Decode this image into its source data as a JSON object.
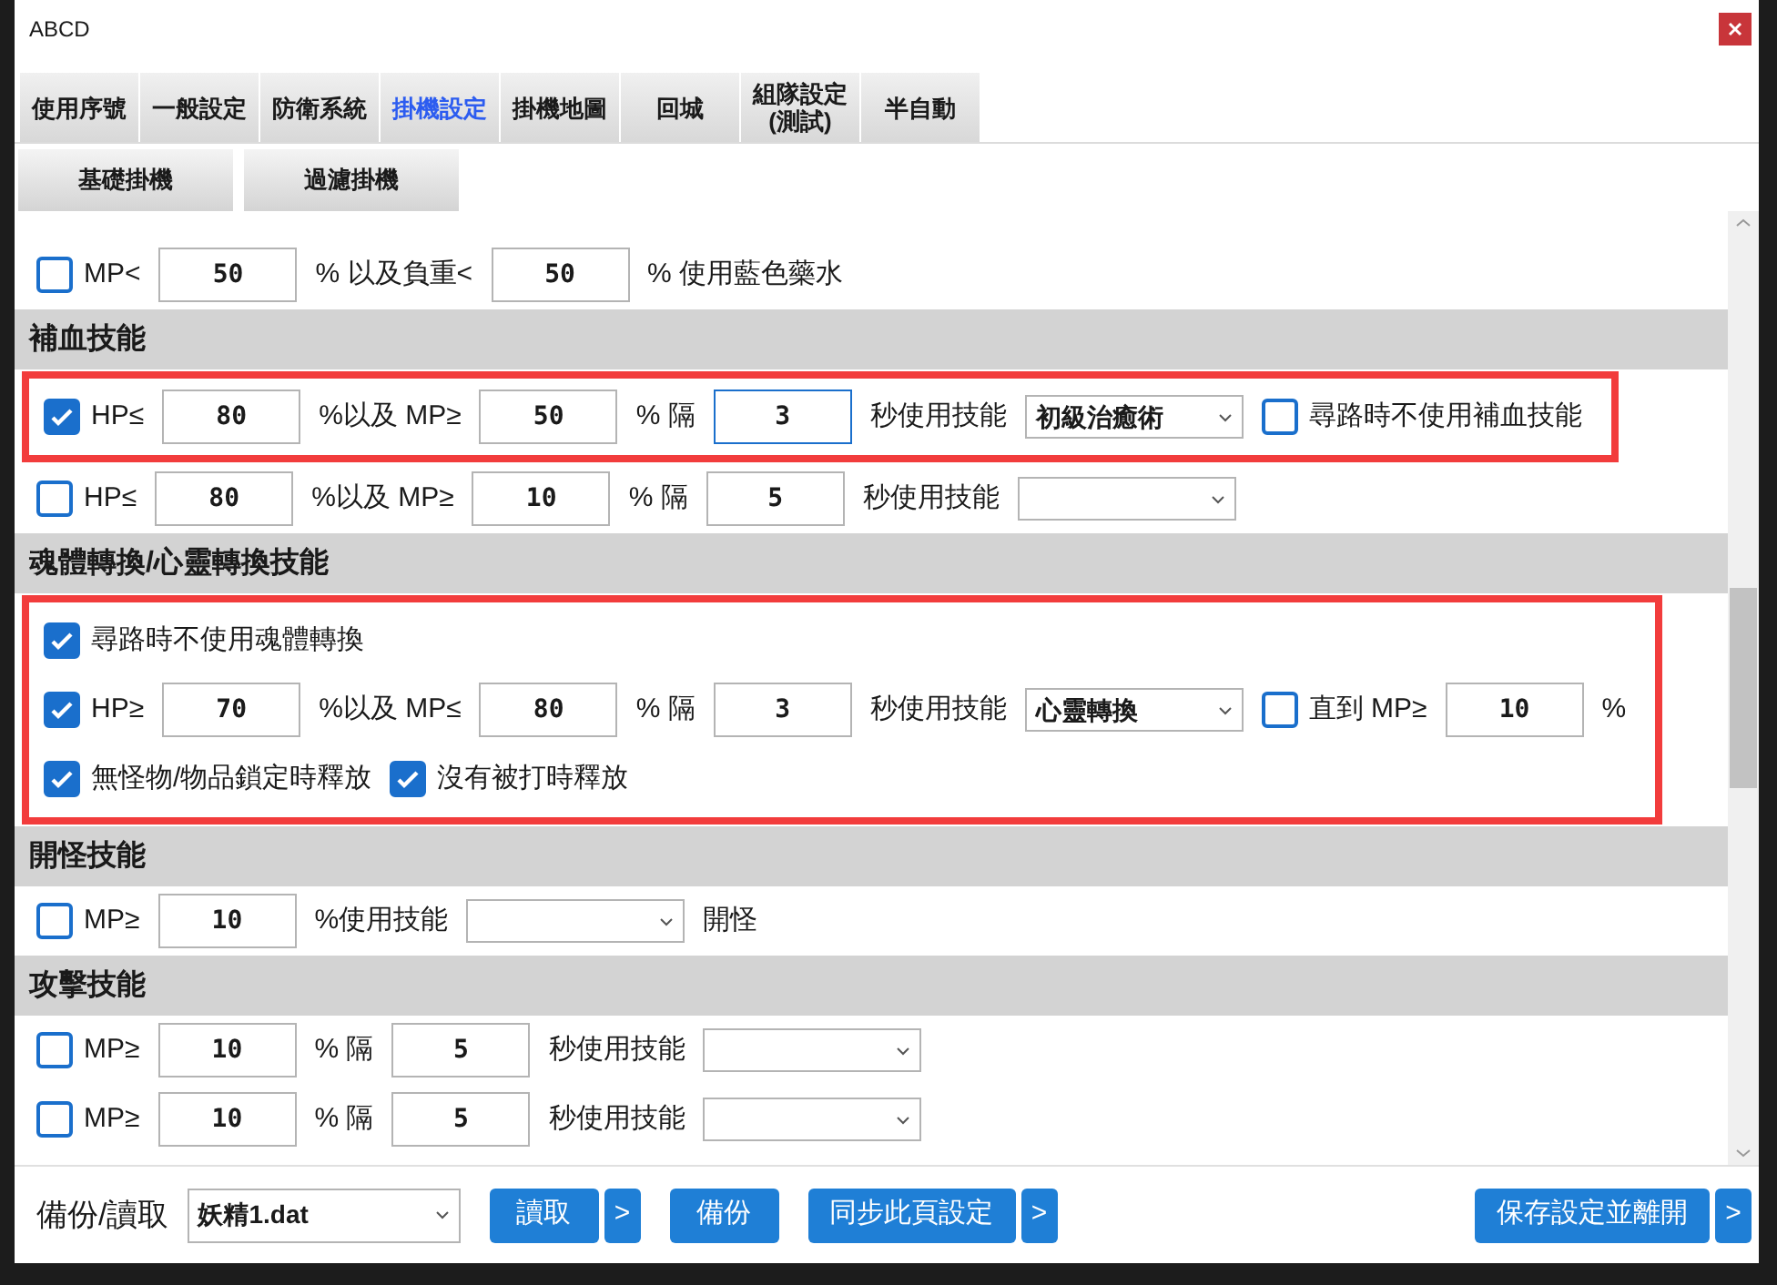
{
  "window": {
    "title": "ABCD"
  },
  "tabs": [
    {
      "label": "使用序號",
      "selected": false
    },
    {
      "label": "一般設定",
      "selected": false
    },
    {
      "label": "防衛系統",
      "selected": false
    },
    {
      "label": "掛機設定",
      "selected": true
    },
    {
      "label": "掛機地圖",
      "selected": false
    },
    {
      "label": "回城",
      "selected": false
    },
    {
      "label": "組隊設定\n(測試)",
      "selected": false
    },
    {
      "label": "半自動",
      "selected": false
    }
  ],
  "subtabs": [
    {
      "label": "基礎掛機"
    },
    {
      "label": "過濾掛機"
    }
  ],
  "sections": [
    {
      "groups": [
        {
          "highlighted": false,
          "rows": [
            {
              "parts": [
                {
                  "kind": "checkbox",
                  "label": "MP<",
                  "checked": false
                },
                {
                  "kind": "input",
                  "value": "50",
                  "focused": false
                },
                {
                  "kind": "text",
                  "text": "% 以及負重<"
                },
                {
                  "kind": "input",
                  "value": "50",
                  "focused": false
                },
                {
                  "kind": "text",
                  "text": "% 使用藍色藥水"
                }
              ]
            }
          ]
        }
      ]
    },
    {
      "title": "補血技能",
      "groups": [
        {
          "highlighted": true,
          "rows": [
            {
              "parts": [
                {
                  "kind": "checkbox",
                  "label": "HP≤",
                  "checked": true
                },
                {
                  "kind": "input",
                  "value": "80",
                  "focused": false
                },
                {
                  "kind": "text",
                  "text": "%以及 MP≥"
                },
                {
                  "kind": "input",
                  "value": "50",
                  "focused": false
                },
                {
                  "kind": "text",
                  "text": "% 隔"
                },
                {
                  "kind": "input",
                  "value": "3",
                  "focused": true
                },
                {
                  "kind": "text",
                  "text": "秒使用技能"
                },
                {
                  "kind": "select",
                  "value": "初級治癒術"
                },
                {
                  "kind": "checkbox",
                  "label": "尋路時不使用補血技能",
                  "checked": false
                }
              ]
            }
          ]
        },
        {
          "highlighted": false,
          "rows": [
            {
              "parts": [
                {
                  "kind": "checkbox",
                  "label": "HP≤",
                  "checked": false
                },
                {
                  "kind": "input",
                  "value": "80",
                  "focused": false
                },
                {
                  "kind": "text",
                  "text": "%以及 MP≥"
                },
                {
                  "kind": "input",
                  "value": "10",
                  "focused": false
                },
                {
                  "kind": "text",
                  "text": "% 隔"
                },
                {
                  "kind": "input",
                  "value": "5",
                  "focused": false
                },
                {
                  "kind": "text",
                  "text": "秒使用技能"
                },
                {
                  "kind": "select"
                }
              ]
            }
          ]
        }
      ]
    },
    {
      "title": "魂體轉換/心靈轉換技能",
      "groups": [
        {
          "highlighted": true,
          "rows": [
            {
              "parts": [
                {
                  "kind": "checkbox",
                  "label": "尋路時不使用魂體轉換",
                  "checked": true
                }
              ]
            },
            {
              "parts": [
                {
                  "kind": "checkbox",
                  "label": "HP≥",
                  "checked": true
                },
                {
                  "kind": "input",
                  "value": "70",
                  "focused": false
                },
                {
                  "kind": "text",
                  "text": "%以及 MP≤"
                },
                {
                  "kind": "input",
                  "value": "80",
                  "focused": false
                },
                {
                  "kind": "text",
                  "text": "% 隔"
                },
                {
                  "kind": "input",
                  "value": "3",
                  "focused": false
                },
                {
                  "kind": "text",
                  "text": "秒使用技能"
                },
                {
                  "kind": "select",
                  "value": "心靈轉換"
                },
                {
                  "kind": "checkbox",
                  "label": "直到 MP≥",
                  "checked": false
                },
                {
                  "kind": "input",
                  "value": "10",
                  "focused": false
                },
                {
                  "kind": "text",
                  "text": "%"
                }
              ]
            },
            {
              "parts": [
                {
                  "kind": "checkbox",
                  "label": "無怪物/物品鎖定時釋放",
                  "checked": true
                },
                {
                  "kind": "checkbox",
                  "label": "沒有被打時釋放",
                  "checked": true
                }
              ]
            }
          ]
        }
      ]
    },
    {
      "title": "開怪技能",
      "groups": [
        {
          "highlighted": false,
          "rows": [
            {
              "parts": [
                {
                  "kind": "checkbox",
                  "label": "MP≥",
                  "checked": false
                },
                {
                  "kind": "input",
                  "value": "10",
                  "focused": false
                },
                {
                  "kind": "text",
                  "text": "%使用技能"
                },
                {
                  "kind": "select"
                },
                {
                  "kind": "text",
                  "text": "開怪"
                }
              ]
            }
          ]
        }
      ]
    },
    {
      "title": "攻擊技能",
      "groups": [
        {
          "highlighted": false,
          "rows": [
            {
              "parts": [
                {
                  "kind": "checkbox",
                  "label": "MP≥",
                  "checked": false
                },
                {
                  "kind": "input",
                  "value": "10",
                  "focused": false
                },
                {
                  "kind": "text",
                  "text": "% 隔"
                },
                {
                  "kind": "input",
                  "value": "5",
                  "focused": false
                },
                {
                  "kind": "text",
                  "text": "秒使用技能"
                },
                {
                  "kind": "select"
                }
              ]
            },
            {
              "parts": [
                {
                  "kind": "checkbox",
                  "label": "MP≥",
                  "checked": false
                },
                {
                  "kind": "input",
                  "value": "10",
                  "focused": false
                },
                {
                  "kind": "text",
                  "text": "% 隔"
                },
                {
                  "kind": "input",
                  "value": "5",
                  "focused": false
                },
                {
                  "kind": "text",
                  "text": "秒使用技能"
                },
                {
                  "kind": "select"
                }
              ]
            }
          ]
        }
      ]
    }
  ],
  "footer": {
    "label": "備份/讀取",
    "file_select": {
      "value": "妖精1.dat"
    },
    "button_groups": [
      [
        {
          "label": "讀取"
        },
        {
          "label": ">"
        }
      ],
      [
        {
          "label": "備份"
        }
      ],
      [
        {
          "label": "同步此頁設定"
        },
        {
          "label": ">"
        }
      ],
      [
        {
          "label": "保存設定並離開"
        },
        {
          "label": ">"
        }
      ]
    ]
  }
}
